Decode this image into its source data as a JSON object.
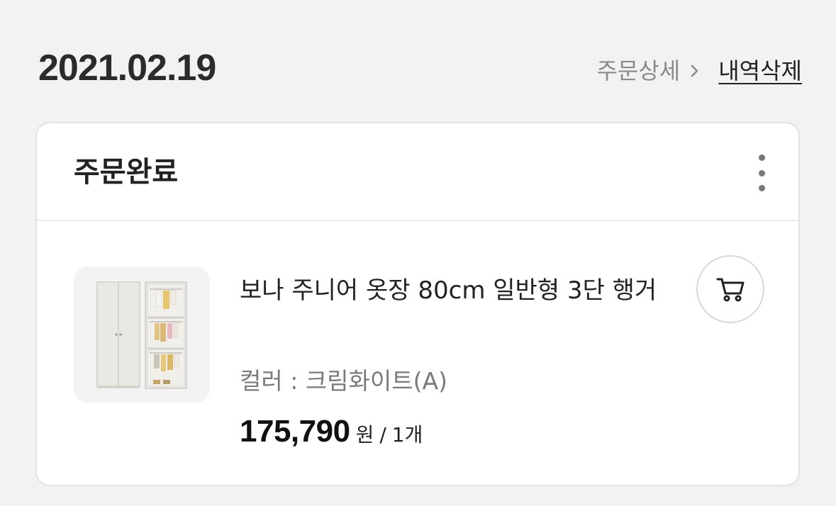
{
  "order": {
    "date": "2021.02.19",
    "detail_label": "주문상세",
    "delete_label": "내역삭제",
    "status": "주문완료"
  },
  "product": {
    "name": "보나 주니어 옷장 80cm 일반형 3단 행거",
    "option": "컬러 : 크림화이트(A)",
    "price": "175,790",
    "price_unit": "원",
    "separator": "/",
    "quantity": "1개"
  },
  "icons": {
    "more": "more-vertical-icon",
    "cart": "cart-icon",
    "chevron": "chevron-right-icon"
  },
  "colors": {
    "background": "#f2f2f2",
    "card": "#ffffff",
    "muted_text": "#8a8a8a",
    "primary_text": "#222222"
  }
}
